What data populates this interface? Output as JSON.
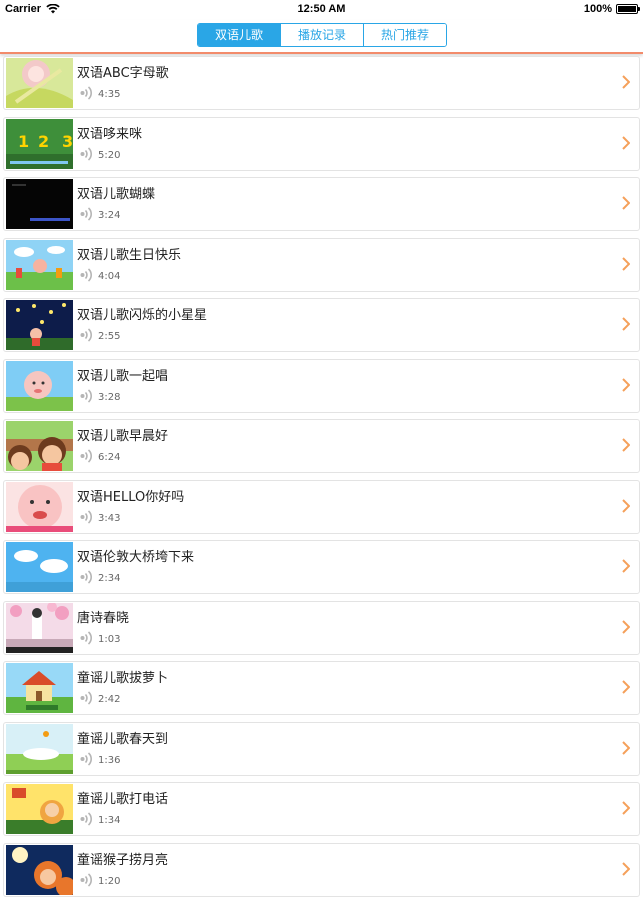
{
  "status_bar": {
    "carrier": "Carrier",
    "time": "12:50 AM",
    "battery_percent": "100%",
    "battery_level": 1.0,
    "wifi_icon": "wifi-icon",
    "battery_icon": "battery-icon"
  },
  "tabs": [
    {
      "label": "双语儿歌",
      "selected": true
    },
    {
      "label": "播放记录",
      "selected": false
    },
    {
      "label": "热门推荐",
      "selected": false
    }
  ],
  "colors": {
    "accent": "#2aa6e6",
    "divider": "#f28b6b",
    "chevron": "#f5a05a",
    "speaker": "#b5b5b5"
  },
  "items": [
    {
      "title": "双语ABC字母歌",
      "duration": "4:35"
    },
    {
      "title": "双语哆来咪",
      "duration": "5:20"
    },
    {
      "title": "双语儿歌蝴蝶",
      "duration": "3:24"
    },
    {
      "title": "双语儿歌生日快乐",
      "duration": "4:04"
    },
    {
      "title": "双语儿歌闪烁的小星星",
      "duration": "2:55"
    },
    {
      "title": "双语儿歌一起唱",
      "duration": "3:28"
    },
    {
      "title": "双语儿歌早晨好",
      "duration": "6:24"
    },
    {
      "title": "双语HELLO你好吗",
      "duration": "3:43"
    },
    {
      "title": "双语伦敦大桥垮下来",
      "duration": "2:34"
    },
    {
      "title": "唐诗春晓",
      "duration": "1:03"
    },
    {
      "title": "童谣儿歌拔萝卜",
      "duration": "2:42"
    },
    {
      "title": "童谣儿歌春天到",
      "duration": "1:36"
    },
    {
      "title": "童谣儿歌打电话",
      "duration": "1:34"
    },
    {
      "title": "童谣猴子捞月亮",
      "duration": "1:20"
    }
  ]
}
